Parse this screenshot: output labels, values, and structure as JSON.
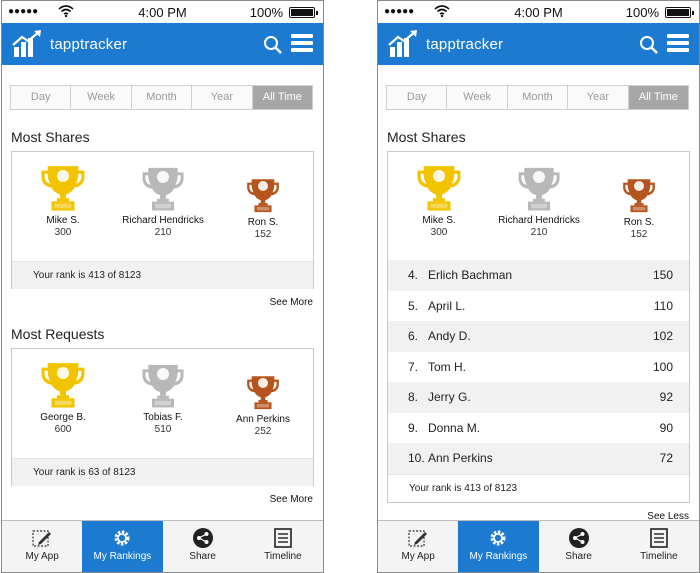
{
  "status": {
    "time": "4:00 PM",
    "battery": "100%"
  },
  "app": {
    "brand": "tapptracker"
  },
  "periods": [
    "Day",
    "Week",
    "Month",
    "Year",
    "All Time"
  ],
  "colors": {
    "brand_blue": "#1c7bd0",
    "gold": "#f2c400",
    "silver": "#b8b8b8",
    "bronze": "#b5541c"
  },
  "left": {
    "shares": {
      "title": "Most Shares",
      "winners": [
        {
          "name": "Mike S.",
          "value": "300"
        },
        {
          "name": "Richard Hendricks",
          "value": "210"
        },
        {
          "name": "Ron S.",
          "value": "152"
        }
      ],
      "rank": "Your rank is 413 of 8123",
      "see": "See More"
    },
    "requests": {
      "title": "Most Requests",
      "winners": [
        {
          "name": "George B.",
          "value": "600"
        },
        {
          "name": "Tobias F.",
          "value": "510"
        },
        {
          "name": "Ann Perkins",
          "value": "252"
        }
      ],
      "rank": "Your rank is 63 of 8123",
      "see": "See More"
    }
  },
  "right": {
    "shares": {
      "title": "Most Shares",
      "winners": [
        {
          "name": "Mike S.",
          "value": "300"
        },
        {
          "name": "Richard Hendricks",
          "value": "210"
        },
        {
          "name": "Ron S.",
          "value": "152"
        }
      ],
      "list": [
        {
          "pos": "4.",
          "name": "Erlich Bachman",
          "value": "150"
        },
        {
          "pos": "5.",
          "name": "April L.",
          "value": "110"
        },
        {
          "pos": "6.",
          "name": "Andy D.",
          "value": "102"
        },
        {
          "pos": "7.",
          "name": "Tom H.",
          "value": "100"
        },
        {
          "pos": "8.",
          "name": "Jerry G.",
          "value": "92"
        },
        {
          "pos": "9.",
          "name": "Donna M.",
          "value": "90"
        },
        {
          "pos": "10.",
          "name": "Ann Perkins",
          "value": "72"
        }
      ],
      "rank": "Your rank is 413 of 8123",
      "see": "See Less"
    }
  },
  "tabs": [
    {
      "label": "My App",
      "icon": "pencil-icon"
    },
    {
      "label": "My Rankings",
      "icon": "gear-icon"
    },
    {
      "label": "Share",
      "icon": "share-icon"
    },
    {
      "label": "Timeline",
      "icon": "list-icon"
    }
  ]
}
